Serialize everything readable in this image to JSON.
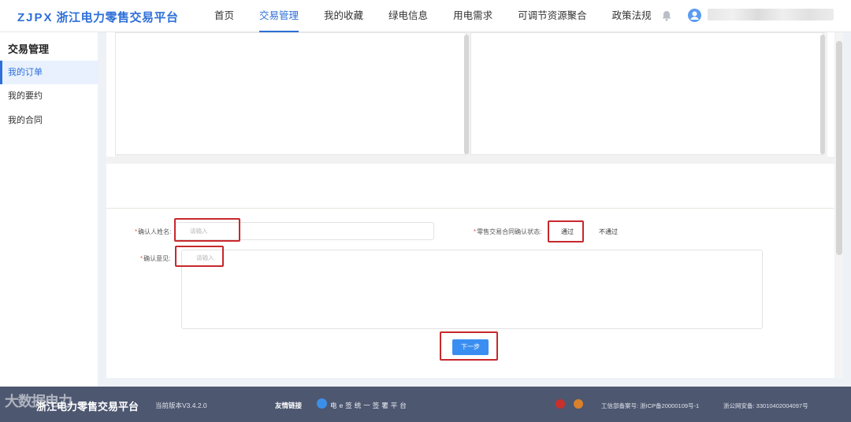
{
  "header": {
    "logo_mark": "ZJPX",
    "logo_text": "浙江电力零售交易平台",
    "nav": [
      {
        "label": "首页",
        "active": false
      },
      {
        "label": "交易管理",
        "active": true
      },
      {
        "label": "我的收藏",
        "active": false
      },
      {
        "label": "绿电信息",
        "active": false
      },
      {
        "label": "用电需求",
        "active": false
      },
      {
        "label": "可调节资源聚合",
        "active": false
      },
      {
        "label": "政策法规",
        "active": false
      }
    ]
  },
  "sidebar": {
    "title": "交易管理",
    "items": [
      {
        "label": "我的订单",
        "active": true
      },
      {
        "label": "我的要约",
        "active": false
      },
      {
        "label": "我的合同",
        "active": false
      }
    ]
  },
  "form": {
    "name_label": "确认人姓名:",
    "name_placeholder": "请输入",
    "status_label": "零售交易合同确认状态:",
    "status_options": [
      "通过",
      "不通过"
    ],
    "opinion_label": "确认意见:",
    "opinion_placeholder": "请输入",
    "next_button": "下一步"
  },
  "footer": {
    "title": "浙江电力零售交易平台",
    "version": "当前版本V3.4.2.0",
    "links_label": "友情链接",
    "esign_text": "电e签统一签署平台",
    "icp": "工信部备案号: 浙ICP备20000109号-1",
    "police": "浙公网安备: 33010402004097号"
  },
  "watermark": "大数据电力",
  "colors": {
    "accent": "#2e6fd8",
    "button": "#3a8ef1",
    "highlight_box": "#c8282c",
    "footer_bg": "#4d5770"
  }
}
